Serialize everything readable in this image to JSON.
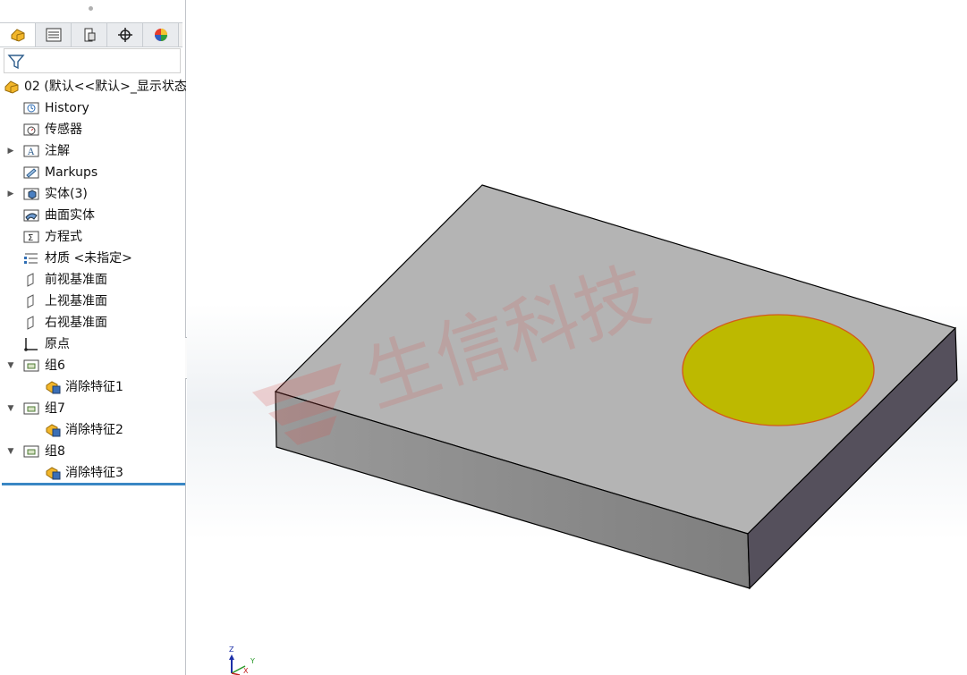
{
  "panel": {
    "tabs": [
      {
        "icon": "feature-manager-icon",
        "active": true
      },
      {
        "icon": "property-manager-icon",
        "active": false
      },
      {
        "icon": "configuration-manager-icon",
        "active": false
      },
      {
        "icon": "dimxpert-icon",
        "active": false
      },
      {
        "icon": "display-manager-icon",
        "active": false
      }
    ],
    "filter_icon": "filter-icon",
    "tree": {
      "root_label": "02  (默认<<默认>_显示状态",
      "items": [
        {
          "label": "History",
          "icon": "history-icon"
        },
        {
          "label": "传感器",
          "icon": "sensors-icon"
        },
        {
          "label": "注解",
          "icon": "annotations-icon",
          "expandable": true
        },
        {
          "label": "Markups",
          "icon": "markups-icon"
        },
        {
          "label": "实体(3)",
          "icon": "solid-bodies-icon",
          "expandable": true
        },
        {
          "label": "曲面实体",
          "icon": "surface-bodies-icon"
        },
        {
          "label": "方程式",
          "icon": "equations-icon"
        },
        {
          "label": "材质 <未指定>",
          "icon": "material-icon"
        },
        {
          "label": "前视基准面",
          "icon": "plane-icon"
        },
        {
          "label": "上视基准面",
          "icon": "plane-icon"
        },
        {
          "label": "右视基准面",
          "icon": "plane-icon"
        },
        {
          "label": "原点",
          "icon": "origin-icon"
        }
      ],
      "groups": [
        {
          "label": "组6",
          "child": "消除特征1"
        },
        {
          "label": "组7",
          "child": "消除特征2"
        },
        {
          "label": "组8",
          "child": "消除特征3"
        }
      ]
    }
  },
  "viewport": {
    "watermark": "生信科技",
    "triad": {
      "z": "Z",
      "y": "Y",
      "x": "X"
    }
  },
  "colors": {
    "selection_bar": "#3a87c4",
    "circle_face": "#bdb900",
    "circle_edge": "#d45a1a",
    "top_face": "#b4b4b4",
    "front_face": "#8c8c8c",
    "side_face": "#55505c",
    "watermark": "#d9534f"
  }
}
